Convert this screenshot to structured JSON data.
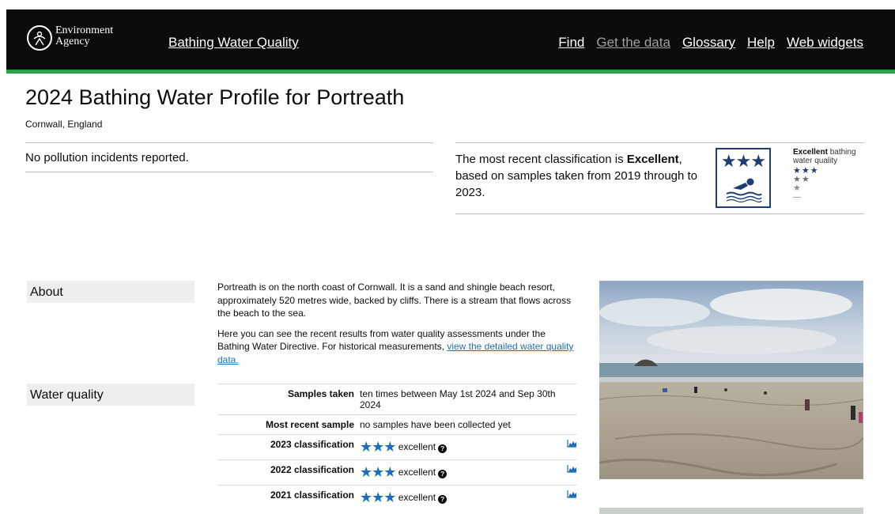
{
  "header": {
    "logo_line1": "Environment",
    "logo_line2": "Agency",
    "app_title": "Bathing Water Quality",
    "nav": [
      {
        "label": "Find",
        "active": true
      },
      {
        "label": "Get the data",
        "active": false
      },
      {
        "label": "Glossary",
        "active": true
      },
      {
        "label": "Help",
        "active": true
      },
      {
        "label": "Web widgets",
        "active": true
      }
    ]
  },
  "page": {
    "title": "2024 Bathing Water Profile for Portreath",
    "location": "Cornwall, England"
  },
  "incidents": {
    "text": "No pollution incidents reported."
  },
  "classification": {
    "text_prefix": "The most recent classification is ",
    "rating": "Excellent",
    "text_suffix": ", based on samples taken from 2019 through to 2023.",
    "legend_title": "Excellent",
    "legend_rest": " bathing water quality",
    "legend_3": "★★★",
    "legend_2": "★★",
    "legend_1": "★",
    "legend_0": "—"
  },
  "sections": {
    "about_label": "About",
    "water_quality_label": "Water quality"
  },
  "about": {
    "p1": "Portreath is on the north coast of Cornwall. It is a sand and shingle beach resort, approximately 520 metres wide, backed by cliffs. There is a stream that flows across the beach to the sea.",
    "p2_prefix": "Here you can see the recent results from water quality assessments under the Bathing Water Directive. For historical measurements, ",
    "p2_link": "view the detailed water quality data.",
    "p2_suffix": ""
  },
  "water_quality": {
    "rows": [
      {
        "key": "Samples taken",
        "value": "ten times between May 1st 2024 and Sep 30th 2024"
      },
      {
        "key": "Most recent sample",
        "value": "no samples have been collected yet"
      },
      {
        "key": "2023 classification",
        "stars": "★★★",
        "value": "excellent"
      },
      {
        "key": "2022 classification",
        "stars": "★★★",
        "value": "excellent"
      },
      {
        "key": "2021 classification",
        "stars": "★★★",
        "value": "excellent"
      }
    ]
  },
  "icons": {
    "logo": "environment-agency-logo",
    "help": "question-circle-icon",
    "chart": "area-chart-icon",
    "swimmer": "swimmer-icon"
  },
  "colors": {
    "header_bg": "#0b0c0c",
    "header_accent": "#2aa24a",
    "star_blue": "#1d70b8",
    "badge_navy": "#1d3d75"
  }
}
